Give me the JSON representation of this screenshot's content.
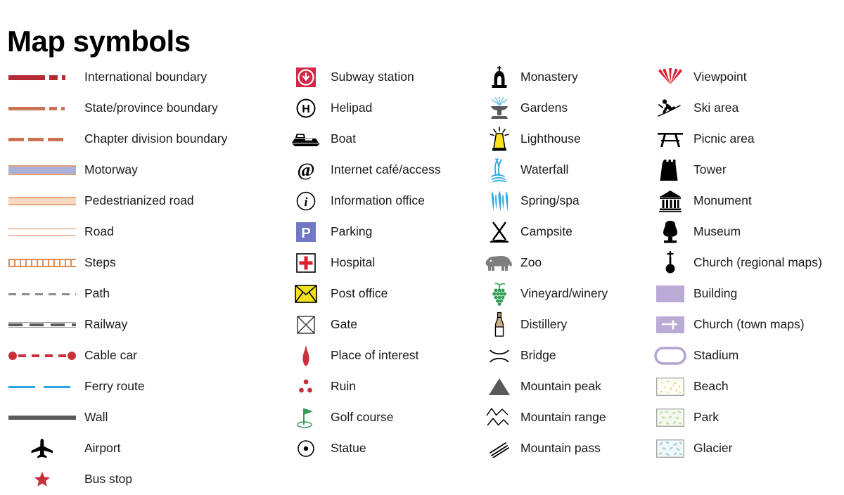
{
  "title": "Map symbols",
  "colors": {
    "international_boundary": "#B42B35",
    "state_boundary": "#CB7253",
    "chapter_boundary": "#CB7253",
    "motorway_fill": "#A9B1D9",
    "motorway_edge": "#E2A077",
    "pedestrian_fill": "#F6D9C0",
    "road_edge": "#E08A55",
    "path": "#8C8C8C",
    "railway": "#5A5A5A",
    "cable_car": "#C8313C",
    "ferry": "#2BA7E2",
    "wall": "#595959",
    "bus_stop": "#C8313C",
    "subway_red": "#D32644",
    "parking_blue": "#6E78C4",
    "hospital_red": "#D9202C",
    "post_yellow": "#F2E21B",
    "golf_green": "#2E9C52",
    "vineyard_green": "#2E9C52",
    "viewpoint_red": "#D8202E",
    "building_purple": "#B9AAD6",
    "lighthouse_yellow": "#FCE119",
    "water_blue": "#2BA7E2",
    "zoo_gray": "#7E7E7E",
    "peak_gray": "#58595B",
    "beach_fill": "#FFFDF2",
    "park_fill": "#F3F8EC",
    "glacier_fill": "#EFF7FA"
  },
  "columns": [
    {
      "name": "lines-column",
      "items": [
        {
          "icon": "international-boundary-line",
          "label": "International boundary"
        },
        {
          "icon": "state-province-boundary-line",
          "label": "State/province boundary"
        },
        {
          "icon": "chapter-division-boundary-line",
          "label": "Chapter division boundary"
        },
        {
          "icon": "motorway-line",
          "label": "Motorway"
        },
        {
          "icon": "pedestrianized-road-line",
          "label": "Pedestrianized road"
        },
        {
          "icon": "road-line",
          "label": "Road"
        },
        {
          "icon": "steps-line",
          "label": "Steps"
        },
        {
          "icon": "path-line",
          "label": "Path"
        },
        {
          "icon": "railway-line",
          "label": "Railway"
        },
        {
          "icon": "cable-car-line",
          "label": "Cable car"
        },
        {
          "icon": "ferry-route-line",
          "label": "Ferry route"
        },
        {
          "icon": "wall-line",
          "label": "Wall"
        },
        {
          "icon": "airport-icon",
          "label": "Airport"
        },
        {
          "icon": "bus-stop-icon",
          "label": "Bus stop"
        }
      ]
    },
    {
      "name": "transport-services-column",
      "items": [
        {
          "icon": "subway-station-icon",
          "label": "Subway station"
        },
        {
          "icon": "helipad-icon",
          "label": "Helipad"
        },
        {
          "icon": "boat-icon",
          "label": "Boat"
        },
        {
          "icon": "internet-cafe-icon",
          "label": "Internet café/access"
        },
        {
          "icon": "information-office-icon",
          "label": "Information office"
        },
        {
          "icon": "parking-icon",
          "label": "Parking"
        },
        {
          "icon": "hospital-icon",
          "label": "Hospital"
        },
        {
          "icon": "post-office-icon",
          "label": "Post office"
        },
        {
          "icon": "gate-icon",
          "label": "Gate"
        },
        {
          "icon": "place-of-interest-icon",
          "label": "Place of interest"
        },
        {
          "icon": "ruin-icon",
          "label": "Ruin"
        },
        {
          "icon": "golf-course-icon",
          "label": "Golf course"
        },
        {
          "icon": "statue-icon",
          "label": "Statue"
        }
      ]
    },
    {
      "name": "nature-sights-column",
      "items": [
        {
          "icon": "monastery-icon",
          "label": "Monastery"
        },
        {
          "icon": "gardens-icon",
          "label": "Gardens"
        },
        {
          "icon": "lighthouse-icon",
          "label": "Lighthouse"
        },
        {
          "icon": "waterfall-icon",
          "label": "Waterfall"
        },
        {
          "icon": "spring-spa-icon",
          "label": "Spring/spa"
        },
        {
          "icon": "campsite-icon",
          "label": "Campsite"
        },
        {
          "icon": "zoo-icon",
          "label": "Zoo"
        },
        {
          "icon": "vineyard-winery-icon",
          "label": "Vineyard/winery"
        },
        {
          "icon": "distillery-icon",
          "label": "Distillery"
        },
        {
          "icon": "bridge-icon",
          "label": "Bridge"
        },
        {
          "icon": "mountain-peak-icon",
          "label": "Mountain peak"
        },
        {
          "icon": "mountain-range-icon",
          "label": "Mountain range"
        },
        {
          "icon": "mountain-pass-icon",
          "label": "Mountain pass"
        }
      ]
    },
    {
      "name": "landmarks-areas-column",
      "items": [
        {
          "icon": "viewpoint-icon",
          "label": "Viewpoint"
        },
        {
          "icon": "ski-area-icon",
          "label": "Ski area"
        },
        {
          "icon": "picnic-area-icon",
          "label": "Picnic area"
        },
        {
          "icon": "tower-icon",
          "label": "Tower"
        },
        {
          "icon": "monument-icon",
          "label": "Monument"
        },
        {
          "icon": "museum-icon",
          "label": "Museum"
        },
        {
          "icon": "church-regional-icon",
          "label": "Church (regional maps)"
        },
        {
          "icon": "building-icon",
          "label": "Building"
        },
        {
          "icon": "church-town-icon",
          "label": "Church (town maps)"
        },
        {
          "icon": "stadium-icon",
          "label": "Stadium"
        },
        {
          "icon": "beach-icon",
          "label": "Beach"
        },
        {
          "icon": "park-icon",
          "label": "Park"
        },
        {
          "icon": "glacier-icon",
          "label": "Glacier"
        }
      ]
    }
  ]
}
